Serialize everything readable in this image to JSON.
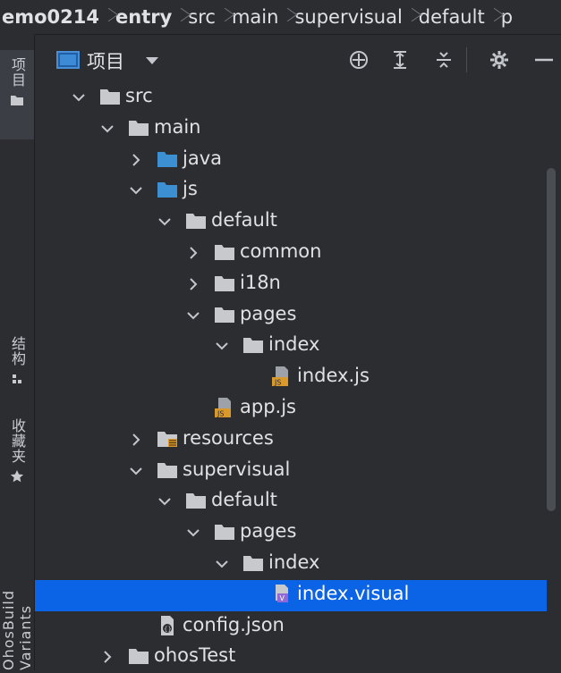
{
  "breadcrumb": [
    {
      "label": "emo0214",
      "bold": true
    },
    {
      "label": "entry",
      "bold": true
    },
    {
      "label": "src",
      "bold": false
    },
    {
      "label": "main",
      "bold": false
    },
    {
      "label": "supervisual",
      "bold": false
    },
    {
      "label": "default",
      "bold": false
    },
    {
      "label": "p",
      "bold": false
    }
  ],
  "left_strip": {
    "project_tab": "项目",
    "structure_tab": "结构",
    "favorites_tab": "收藏夹",
    "build_variants_tab": "OhosBuild Variants"
  },
  "toolbar": {
    "title": "项目",
    "buttons": [
      "locate-icon",
      "expand-all-icon",
      "collapse-all-icon",
      "settings-icon",
      "hide-icon"
    ]
  },
  "tree": [
    {
      "label": "src",
      "level": 3,
      "expanded": true,
      "type": "folder"
    },
    {
      "label": "main",
      "level": 4,
      "expanded": true,
      "type": "folder"
    },
    {
      "label": "java",
      "level": 5,
      "expanded": false,
      "type": "source-folder"
    },
    {
      "label": "js",
      "level": 5,
      "expanded": true,
      "type": "source-folder"
    },
    {
      "label": "default",
      "level": 6,
      "expanded": true,
      "type": "folder"
    },
    {
      "label": "common",
      "level": 7,
      "expanded": false,
      "type": "folder"
    },
    {
      "label": "i18n",
      "level": 7,
      "expanded": false,
      "type": "folder"
    },
    {
      "label": "pages",
      "level": 7,
      "expanded": true,
      "type": "folder"
    },
    {
      "label": "index",
      "level": 8,
      "expanded": true,
      "type": "folder"
    },
    {
      "label": "index.js",
      "level": 9,
      "expanded": null,
      "type": "js-file"
    },
    {
      "label": "app.js",
      "level": 7,
      "expanded": null,
      "type": "js-file"
    },
    {
      "label": "resources",
      "level": 5,
      "expanded": false,
      "type": "resources-folder"
    },
    {
      "label": "supervisual",
      "level": 5,
      "expanded": true,
      "type": "folder"
    },
    {
      "label": "default",
      "level": 6,
      "expanded": true,
      "type": "folder"
    },
    {
      "label": "pages",
      "level": 7,
      "expanded": true,
      "type": "folder"
    },
    {
      "label": "index",
      "level": 8,
      "expanded": true,
      "type": "folder"
    },
    {
      "label": "index.visual",
      "level": 9,
      "expanded": null,
      "type": "visual-file",
      "selected": true
    },
    {
      "label": "config.json",
      "level": 5,
      "expanded": null,
      "type": "json-file"
    },
    {
      "label": "ohosTest",
      "level": 4,
      "expanded": false,
      "type": "folder"
    }
  ],
  "colors": {
    "background": "#2b2d30",
    "selection": "#0b63e6",
    "folder_gray": "#c7c9cd",
    "folder_blue": "#3c8fd0",
    "js_badge": "#d99a2b"
  }
}
